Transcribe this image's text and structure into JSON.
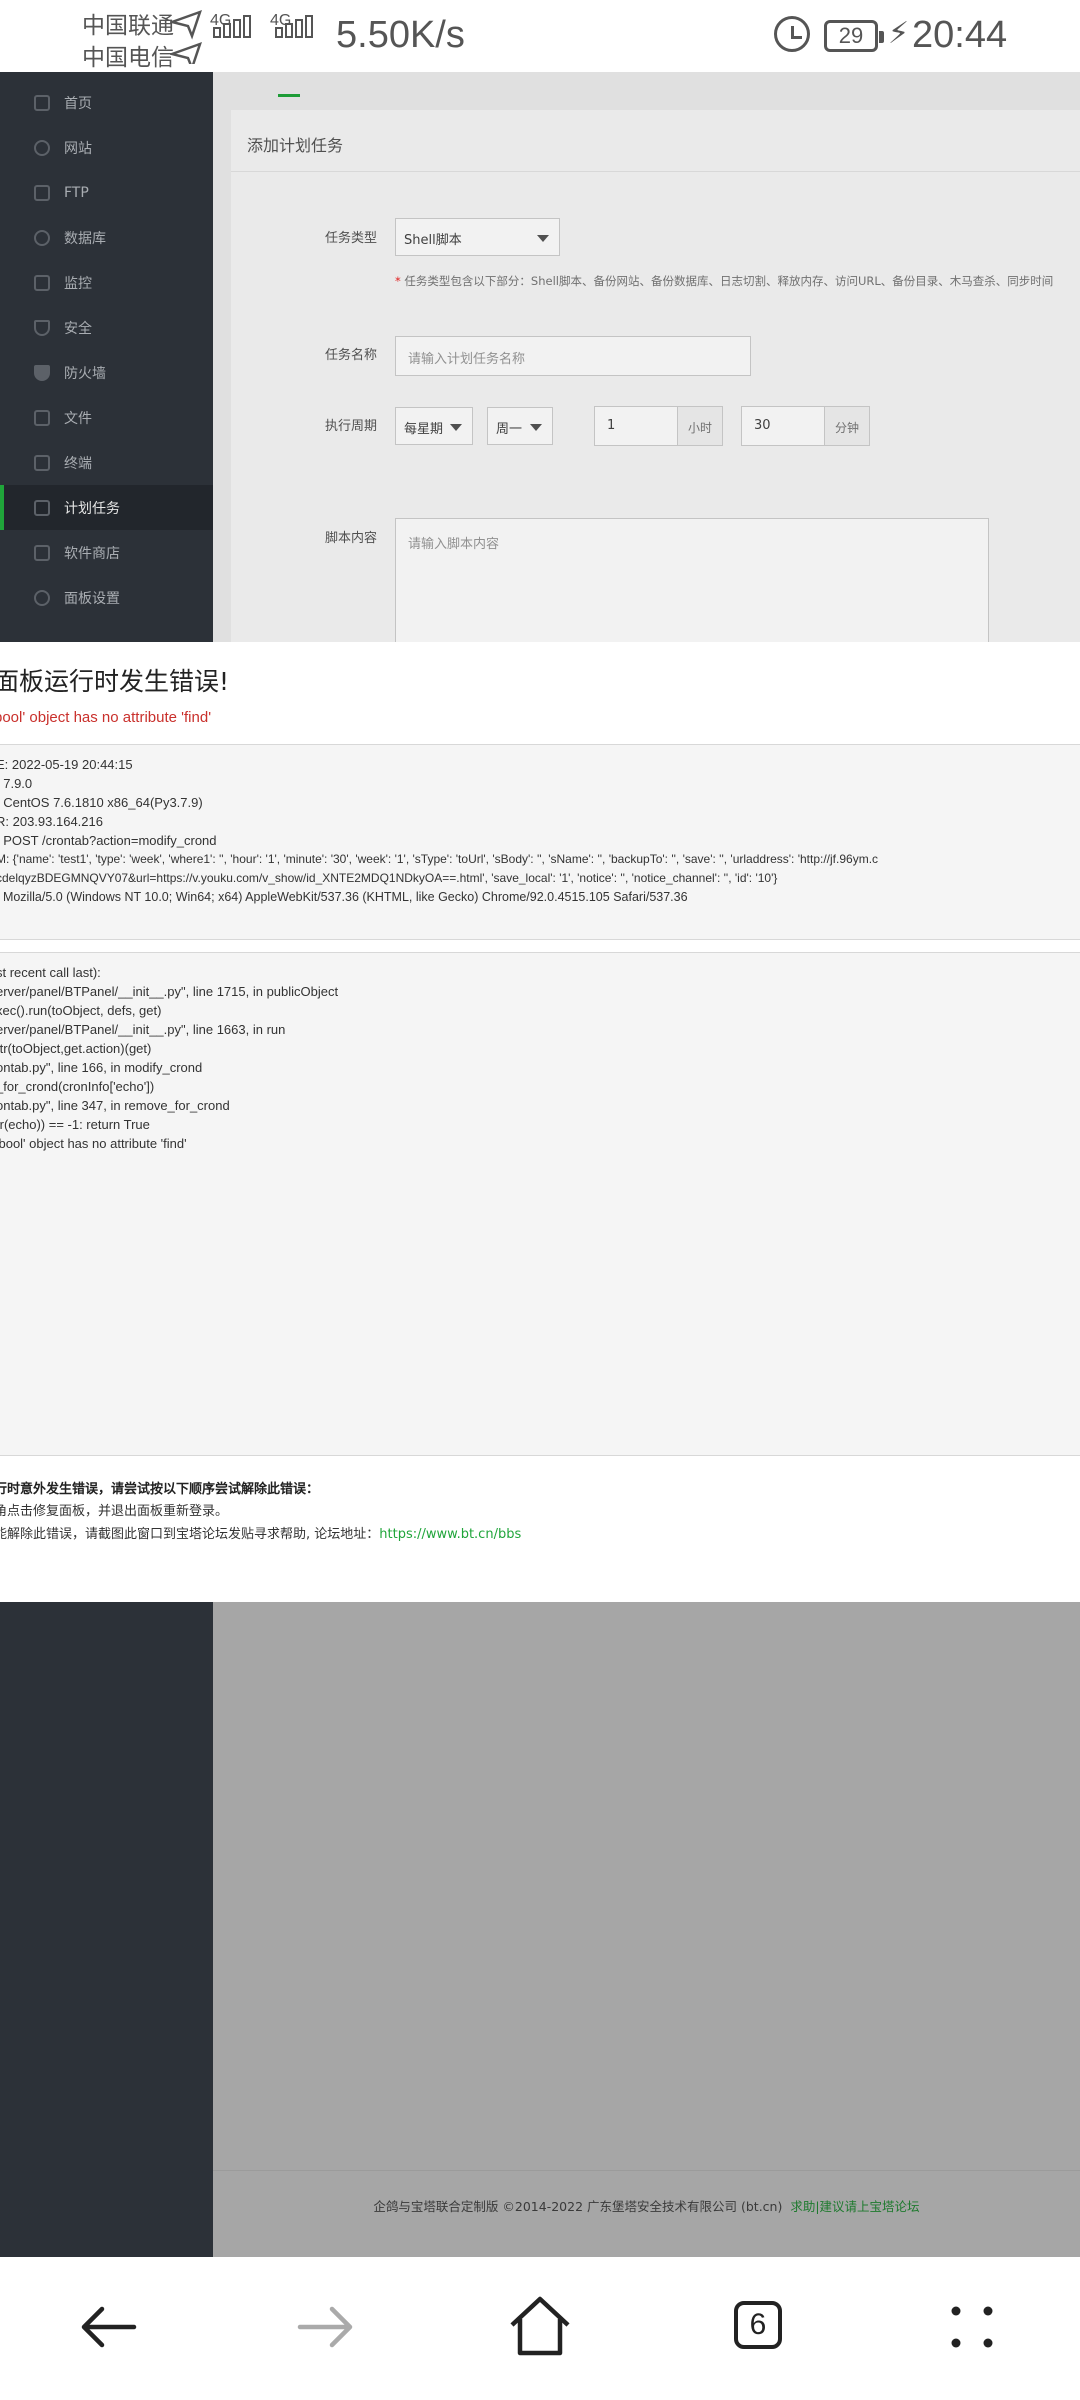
{
  "status_bar": {
    "carrier1": "中国联通",
    "carrier2": "中国电信",
    "network_tag": "4G",
    "net_speed": "5.50K/s",
    "battery": "29",
    "time": "20:44"
  },
  "sidebar": {
    "items": [
      {
        "label": "首页",
        "icon": "home-icon"
      },
      {
        "label": "网站",
        "icon": "globe-icon"
      },
      {
        "label": "FTP",
        "icon": "ftp-icon"
      },
      {
        "label": "数据库",
        "icon": "database-icon"
      },
      {
        "label": "监控",
        "icon": "monitor-icon"
      },
      {
        "label": "安全",
        "icon": "shield-icon"
      },
      {
        "label": "防火墙",
        "icon": "firewall-icon"
      },
      {
        "label": "文件",
        "icon": "folder-icon"
      },
      {
        "label": "终端",
        "icon": "terminal-icon"
      },
      {
        "label": "计划任务",
        "icon": "calendar-icon",
        "active": true
      },
      {
        "label": "软件商店",
        "icon": "apps-icon"
      },
      {
        "label": "面板设置",
        "icon": "gear-icon"
      }
    ]
  },
  "form": {
    "title": "添加计划任务",
    "task_type_label": "任务类型",
    "task_type_value": "Shell脚本",
    "task_type_hint": "任务类型包含以下部分：Shell脚本、备份网站、备份数据库、日志切割、释放内存、访问URL、备份目录、木马查杀、同步时间",
    "task_name_label": "任务名称",
    "task_name_placeholder": "请输入计划任务名称",
    "period_label": "执行周期",
    "period_type": "每星期",
    "period_day": "周一",
    "hour_value": "1",
    "hour_unit": "小时",
    "minute_value": "30",
    "minute_unit": "分钟",
    "script_label": "脚本内容",
    "script_placeholder": "请输入脚本内容"
  },
  "error": {
    "title": "面板运行时发生错误!",
    "message": "bool' object has no attribute 'find'",
    "info_lines": [
      "E: 2022-05-19 20:44:15",
      ": 7.9.0",
      ": CentOS  7.6.1810 x86_64(Py3.7.9)",
      "R: 203.93.164.216",
      ": POST /crontab?action=modify_crond",
      "M: {'name': 'test1', 'type': 'week', 'where1': '', 'hour': '1', 'minute': '30', 'week': '1', 'sType': 'toUrl', 'sBody': '', 'sName': '', 'backupTo': '', 'save': '', 'urladdress': 'http://jf.96ym.c",
      "cdelqyzBDEGMNQVY07&url=https://v.youku.com/v_show/id_XNTE2MDQ1NDkyOA==.html', 'save_local': '1', 'notice': '', 'notice_channel': '', 'id': '10'}",
      ": Mozilla/5.0 (Windows NT 10.0; Win64; x64) AppleWebKit/537.36 (KHTML, like Gecko) Chrome/92.0.4515.105 Safari/537.36"
    ],
    "trace_lines": [
      "st recent call last):",
      "erver/panel/BTPanel/__init__.py\", line 1715, in publicObject",
      "xec().run(toObject, defs, get)",
      "erver/panel/BTPanel/__init__.py\", line 1663, in run",
      "ttr(toObject,get.action)(get)",
      "ontab.py\", line 166, in modify_crond",
      "_for_crond(cronInfo['echo'])",
      "ontab.py\", line 347, in remove_for_crond",
      "tr(echo)) == -1: return True",
      "'bool' object has no attribute 'find'"
    ],
    "help_title": "行时意外发生错误，请尝试按以下顺序尝试解除此错误：",
    "help_line1": "角点击修复面板，并退出面板重新登录。",
    "help_line2": "能解除此错误，请截图此窗口到宝塔论坛发贴寻求帮助, 论坛地址：",
    "help_link": "https://www.bt.cn/bbs"
  },
  "footer": {
    "text": "企鸽与宝塔联合定制版 ©2014-2022 广东堡塔安全技术有限公司 (bt.cn)",
    "link": "求助|建议请上宝塔论坛"
  },
  "nav": {
    "tab_count": "6"
  }
}
